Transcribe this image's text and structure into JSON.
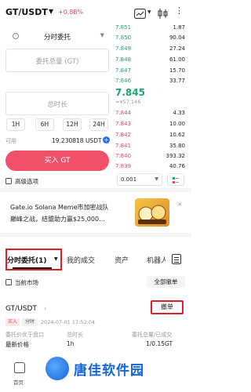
{
  "header": {
    "pair": "GT/USDT",
    "change": "+0.88%"
  },
  "order_form": {
    "order_type": "分时委托",
    "total_placeholder": "委托总量 (GT)",
    "duration_placeholder": "总时长",
    "durations": [
      "1H",
      "6H",
      "12H",
      "24H"
    ],
    "available_label": "可用",
    "available_value": "19.230818 USDT",
    "buy_button": "买入 GT",
    "advanced": "高级选项"
  },
  "order_book": {
    "asks": [
      {
        "price": "7.851",
        "qty": "1.87"
      },
      {
        "price": "7.850",
        "qty": "90.04"
      },
      {
        "price": "7.849",
        "qty": "27.24"
      },
      {
        "price": "7.848",
        "qty": "61.00"
      },
      {
        "price": "7.847",
        "qty": "15.70"
      },
      {
        "price": "7.846",
        "qty": "33.77"
      }
    ],
    "last_price": "7.845",
    "last_price_fiat": "≈¥57,146",
    "bids": [
      {
        "price": "7.844",
        "qty": "4.33"
      },
      {
        "price": "7.843",
        "qty": "10.00"
      },
      {
        "price": "7.842",
        "qty": "10.62"
      },
      {
        "price": "7.841",
        "qty": "35.80"
      },
      {
        "price": "7.840",
        "qty": "393.32"
      },
      {
        "price": "7.839",
        "qty": "40.76"
      }
    ],
    "depth": "0.001"
  },
  "banner": {
    "line1": "Gate.io Solana Meme市加密战队",
    "line2": "巅峰之战，结盟助力赢$25,000...",
    "close": "×"
  },
  "tabs": [
    {
      "label": "分时委托(1)"
    },
    {
      "label": "我的成交"
    },
    {
      "label": "资产"
    },
    {
      "label": "机器人"
    }
  ],
  "filters": {
    "current_market": "当前市场",
    "cancel_all": "全部撤单"
  },
  "order": {
    "pair": "GT/USDT",
    "cancel": "撤单",
    "side": "买入",
    "type": "分时",
    "time": "2024-07-01 17:52:04",
    "labels": [
      "委托价优于盘口",
      "总时长",
      "委托总量/已成交"
    ],
    "values": [
      "最新价格",
      "1h",
      "1/0.15GT"
    ]
  },
  "bottom_nav": {
    "home": "首页"
  },
  "watermark": "唐佳软件园",
  "colors": {
    "ask": "#1fa372",
    "bid": "#e5465a",
    "buy_button": "#f0506a",
    "highlight": "#e11d2c"
  }
}
